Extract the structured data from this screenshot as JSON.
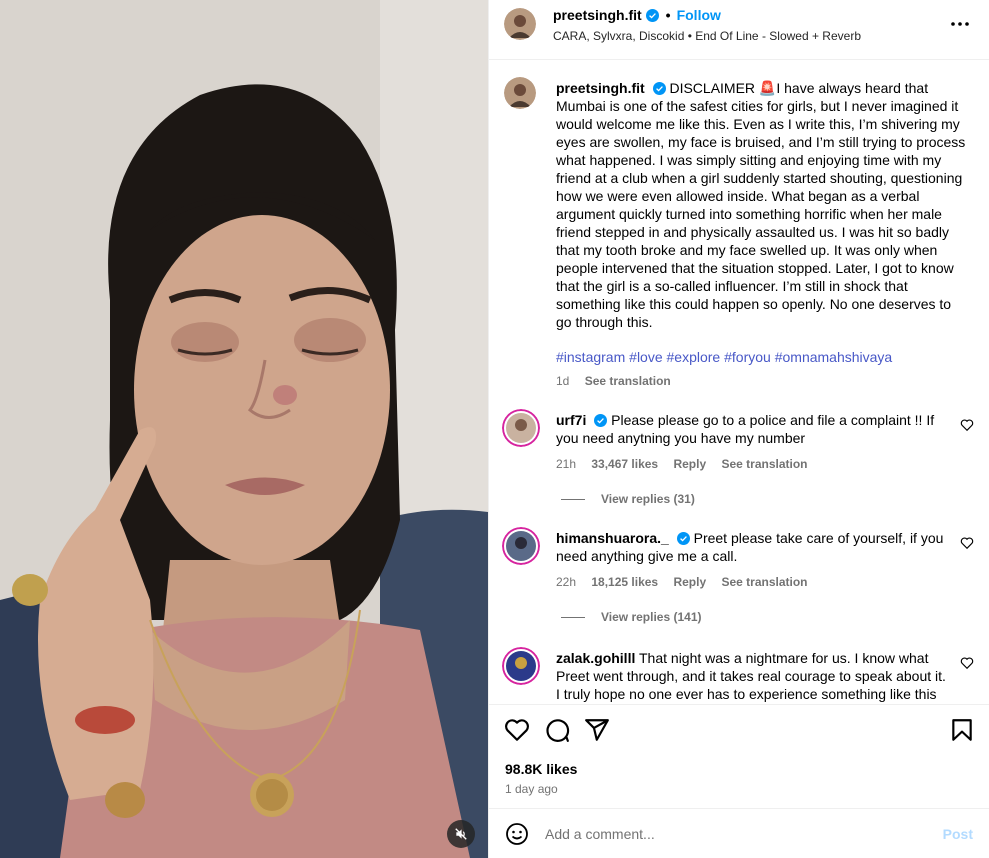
{
  "post": {
    "username": "preetsingh.fit",
    "separator": "•",
    "follow_label": "Follow",
    "audio": "CARA, Sylvxra, Discokid • End Of Line - Slowed + Reverb",
    "caption_user": "preetsingh.fit",
    "caption": "DISCLAIMER 🚨I have always heard that Mumbai is one of the safest cities for girls, but I never imagined it would welcome me like this. Even as I write this, I’m shivering my eyes are swollen, my face is bruised, and I’m still trying to process what happened. I was simply sitting and enjoying time with my friend at a club when a girl suddenly started shouting, questioning how we were even allowed inside. What began as a verbal argument quickly turned into something horrific when her male friend stepped in and physically assaulted us. I was hit so badly that my tooth broke and my face swelled up. It was only when people intervened that the situation stopped. Later, I got to know that the girl is a so-called influencer. I’m still in shock that something like this could happen so openly. No one deserves to go through this.",
    "hashtags": [
      "#instagram",
      "#love",
      "#explore",
      "#foryou",
      "#omnamahshivaya"
    ],
    "time": "1d",
    "see_translation": "See translation",
    "likes": "98.8K likes",
    "posted_ago": "1 day ago"
  },
  "comments": [
    {
      "username": "urf7i",
      "verified": true,
      "text": "Please please go to a police and file a complaint !! If you need anytning you have my number",
      "time": "21h",
      "likes": "33,467 likes",
      "reply": "Reply",
      "see_translation": "See translation",
      "view_replies": "View replies (31)"
    },
    {
      "username": "himanshuarora._",
      "verified": true,
      "text": "Preet please take care of yourself, if you need anything give me a call.",
      "time": "22h",
      "likes": "18,125 likes",
      "reply": "Reply",
      "see_translation": "See translation",
      "view_replies": "View replies (141)"
    },
    {
      "username": "zalak.gohilll",
      "verified": false,
      "text": "That night was a nightmare for us. I know what Preet went through, and it takes real courage to speak about it. I truly hope no one ever has to experience something like this"
    }
  ],
  "composer": {
    "placeholder": "Add a comment...",
    "post_label": "Post"
  },
  "icons": {
    "more": "more-options-icon",
    "verified": "verified-badge-icon",
    "like": "heart-icon",
    "comment": "comment-icon",
    "share": "share-icon",
    "save": "bookmark-icon",
    "emoji": "emoji-icon",
    "mute": "muted-speaker-icon"
  },
  "colors": {
    "link_blue": "#0095f6",
    "hashtag": "#4858c7",
    "verified": "#0095f6",
    "secondary_text": "#737373",
    "post_disabled": "#b3dbff"
  }
}
